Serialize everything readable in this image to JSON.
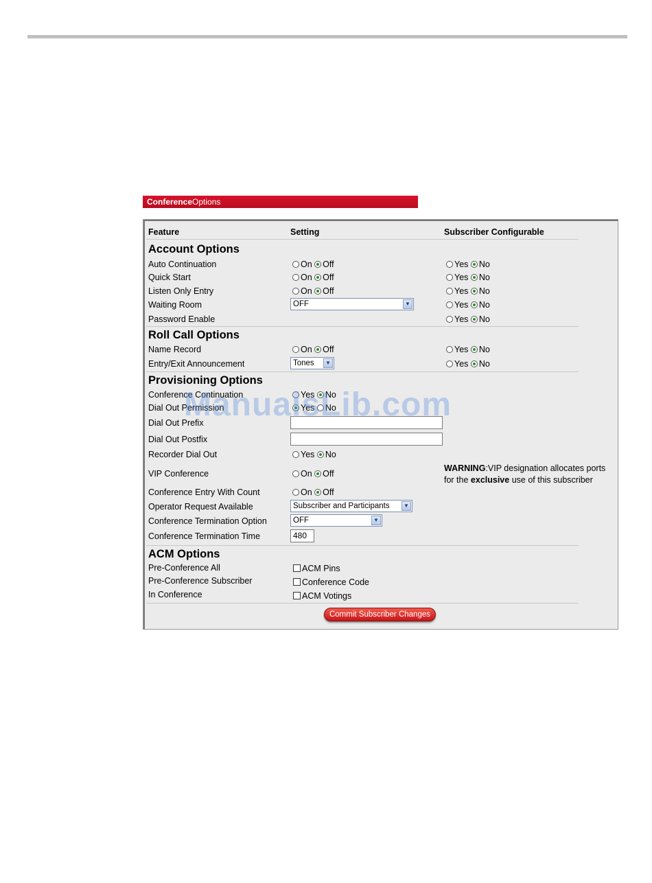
{
  "header": {
    "title_bold": "Conference",
    "title_normal": "Options"
  },
  "columns": {
    "feature": "Feature",
    "setting": "Setting",
    "subscriber": "Subscriber Configurable"
  },
  "labels": {
    "on": "On",
    "off": "Off",
    "yes": "Yes",
    "no": "No"
  },
  "account": {
    "title": "Account Options",
    "auto_continuation": "Auto Continuation",
    "quick_start": "Quick Start",
    "listen_only": "Listen Only Entry",
    "waiting_room": "Waiting Room",
    "waiting_room_value": "OFF",
    "password_enable": "Password Enable"
  },
  "rollcall": {
    "title": "Roll Call Options",
    "name_record": "Name Record",
    "entry_exit": "Entry/Exit Announcement",
    "entry_exit_value": "Tones"
  },
  "provisioning": {
    "title": "Provisioning Options",
    "conf_continuation": "Conference Continuation",
    "dial_out_permission": "Dial Out Permission",
    "dial_out_prefix": "Dial Out Prefix",
    "dial_out_prefix_value": "",
    "dial_out_postfix": "Dial Out Postfix",
    "dial_out_postfix_value": "",
    "recorder_dial_out": "Recorder Dial Out",
    "vip_conference": "VIP Conference",
    "warning_bold": "WARNING",
    "warning_text1": ":VIP designation allocates ports",
    "warning_text2a": "for the ",
    "warning_text2b": "exclusive",
    "warning_text2c": " use of this subscriber",
    "entry_with_count": "Conference Entry With Count",
    "operator_request": "Operator Request Available",
    "operator_request_value": "Subscriber and Participants",
    "termination_option": "Conference Termination Option",
    "termination_option_value": "OFF",
    "termination_time": "Conference Termination Time",
    "termination_time_value": "480"
  },
  "acm": {
    "title": "ACM Options",
    "pre_all": "Pre-Conference All",
    "pre_subscriber": "Pre-Conference Subscriber",
    "in_conference": "In Conference",
    "acm_pins": "ACM Pins",
    "conference_code": "Conference Code",
    "acm_votings": "ACM Votings"
  },
  "commit_label": "Commit Subscriber Changes",
  "watermark": "ManualsLib.com"
}
